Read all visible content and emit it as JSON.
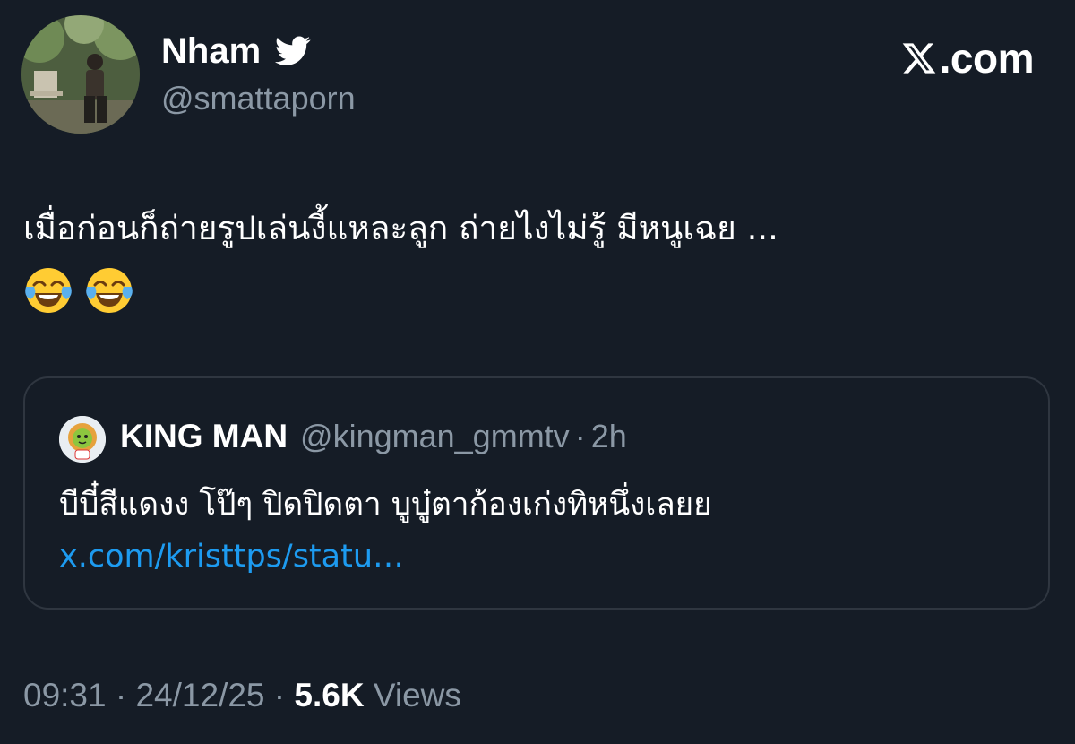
{
  "author": {
    "display_name": "Nham",
    "handle": "@smattaporn",
    "verified_icon": "twitter-bird-icon"
  },
  "brand": {
    "logo": "x-logo-icon",
    "label": ".com"
  },
  "tweet": {
    "text": "เมื่อก่อนก็ถ่ายรูปเล่นงี้แหละลูก ถ่ายไงไม่รู้ มีหนูเฉย  ...",
    "emojis": [
      "face-with-tears-of-joy-icon",
      "face-with-tears-of-joy-icon"
    ]
  },
  "quote": {
    "name": "KING MAN",
    "handle": "@kingman_gmmtv",
    "separator": "·",
    "time": "2h",
    "text": "บีบี๋สีแดงง โป๊ๆ ปิดปิดตา บูบู๋ตาก้องเก่งทิหนึ่งเลยย ",
    "link": "x.com/kristtps/statu…"
  },
  "meta": {
    "time": "09:31",
    "date": "24/12/25",
    "separator": "·",
    "views_count": "5.6K",
    "views_label": "Views"
  },
  "colors": {
    "background": "#151c26",
    "secondary_text": "#8b98a5",
    "link": "#1d9bf0",
    "border": "#2f3640"
  }
}
